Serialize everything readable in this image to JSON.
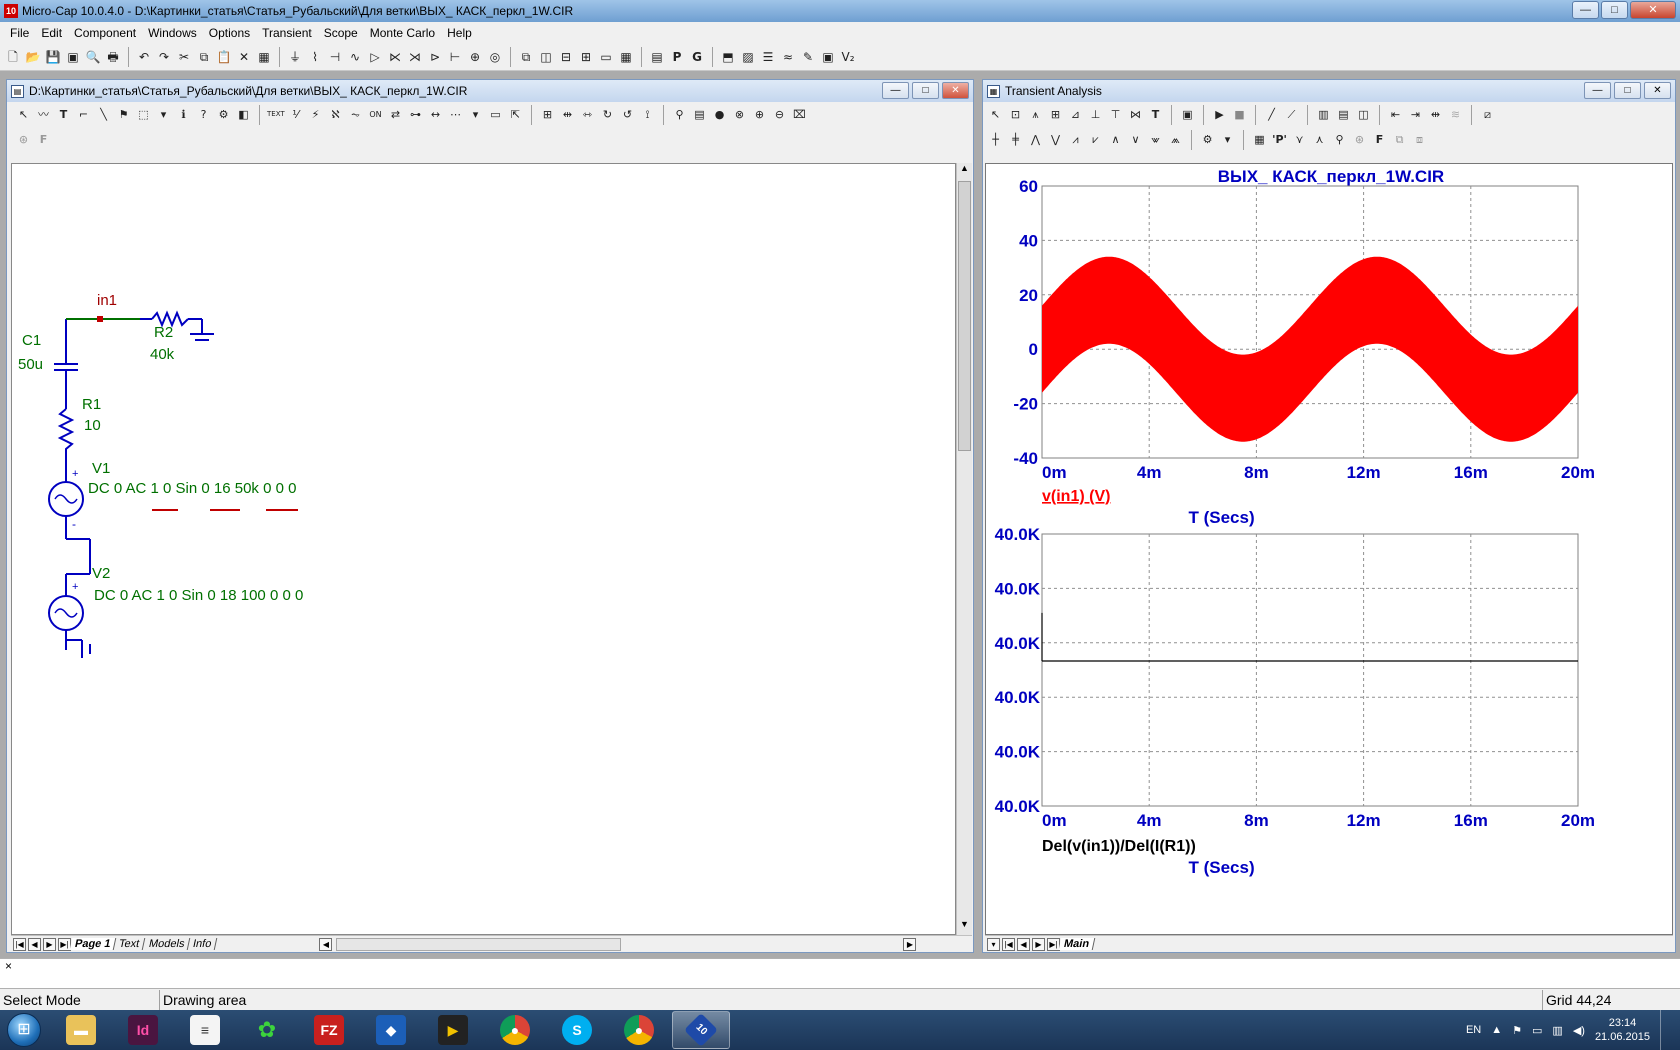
{
  "app": {
    "title": "Micro-Cap 10.0.4.0 - D:\\Картинки_статья\\Статья_Рубальский\\Для ветки\\ВЫХ_ КАСК_перкл_1W.CIR",
    "icon_label": "10"
  },
  "menu": [
    "File",
    "Edit",
    "Component",
    "Windows",
    "Options",
    "Transient",
    "Scope",
    "Monte Carlo",
    "Help"
  ],
  "schematic_window": {
    "title": "D:\\Картинки_статья\\Статья_Рубальский\\Для ветки\\ВЫХ_ КАСК_перкл_1W.CIR",
    "node_label": "in1",
    "components": {
      "c1_name": "C1",
      "c1_value": "50u",
      "r1_name": "R1",
      "r1_value": "10",
      "r2_name": "R2",
      "r2_value": "40k",
      "v1_name": "V1",
      "v1_params": "DC 0 AC 1 0 Sin 0 16 50k 0 0 0",
      "v2_name": "V2",
      "v2_params": "DC 0 AC 1 0 Sin 0 18 100 0 0 0"
    },
    "tabs": [
      "Page 1",
      "Text",
      "Models",
      "Info"
    ],
    "active_tab": "Page 1"
  },
  "analysis_window": {
    "title": "Transient Analysis",
    "tabs": [
      "Main"
    ],
    "active_tab": "Main"
  },
  "chart_data": [
    {
      "type": "area",
      "title": "ВЫХ_ КАСК_перкл_1W.CIR",
      "xlabel": "T (Secs)",
      "ylabel": "",
      "legend": "v(in1) (V)",
      "x_ticks": [
        "0m",
        "4m",
        "8m",
        "12m",
        "16m",
        "20m"
      ],
      "y_ticks": [
        "60",
        "40",
        "20",
        "0",
        "-20",
        "-40"
      ],
      "xlim": [
        0,
        0.02
      ],
      "ylim": [
        -40,
        60
      ],
      "grid": true,
      "series": [
        {
          "name": "v(in1) (V)",
          "color": "#ff0000",
          "envelope": {
            "carrier_amplitude": 16,
            "carrier_frequency_hz": 50000,
            "offset_amplitude": 18,
            "offset_frequency_hz": 100
          },
          "x": [
            0,
            0.0025,
            0.005,
            0.0075,
            0.01,
            0.0125,
            0.015,
            0.0175,
            0.02
          ],
          "upper": [
            16,
            34,
            16,
            -2,
            16,
            34,
            16,
            -2,
            16
          ],
          "lower": [
            -16,
            2,
            -16,
            -34,
            -16,
            2,
            -16,
            -34,
            -16
          ]
        }
      ]
    },
    {
      "type": "line",
      "title": "",
      "xlabel": "T (Secs)",
      "ylabel": "",
      "legend": "Del(v(in1))/Del(I(R1))",
      "x_ticks": [
        "0m",
        "4m",
        "8m",
        "12m",
        "16m",
        "20m"
      ],
      "y_ticks": [
        "40.0K",
        "40.0K",
        "40.0K",
        "40.0K",
        "40.0K",
        "40.0K"
      ],
      "xlim": [
        0,
        0.02
      ],
      "grid": true,
      "series": [
        {
          "name": "Del(v(in1))/Del(I(R1))",
          "color": "#000000",
          "x": [
            0,
            0.02
          ],
          "y": [
            40000,
            40000
          ]
        }
      ]
    }
  ],
  "status": {
    "cmd": "×",
    "mode": "Select Mode",
    "area": "Drawing area",
    "grid": "Grid 44,24"
  },
  "taskbar": {
    "lang": "EN",
    "time": "23:14",
    "date": "21.06.2015",
    "apps": [
      "explorer",
      "indesign",
      "notepad",
      "network",
      "filezilla",
      "vmware",
      "media",
      "chrome",
      "skype",
      "chrome2",
      "microcap"
    ]
  },
  "colors": {
    "schematic_wire": "#0000c0",
    "schematic_label": "#007000",
    "node": "#c00000",
    "chart_axis_text": "#0000c0",
    "waveform": "#ff0000"
  }
}
